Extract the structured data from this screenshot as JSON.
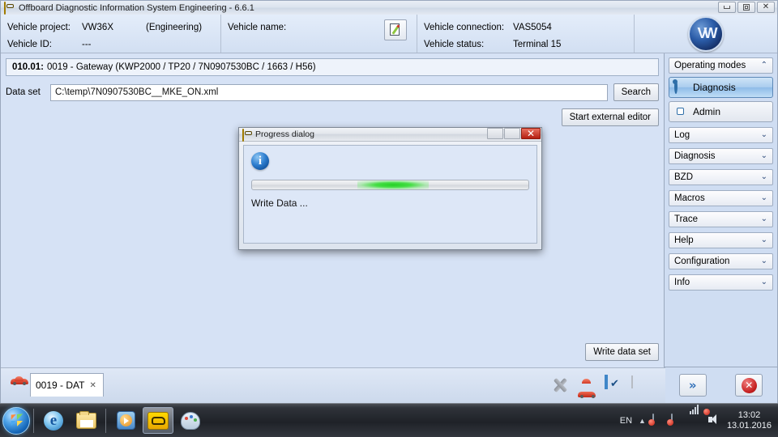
{
  "window": {
    "title": "Offboard Diagnostic Information System Engineering - 6.6.1",
    "icon": "odis-icon",
    "minimize_label": "",
    "maximize_label": "",
    "close_label": "✕"
  },
  "header": {
    "vehicle_project_label": "Vehicle project:",
    "vehicle_project_value": "VW36X",
    "vehicle_project_mode": "(Engineering)",
    "vehicle_id_label": "Vehicle ID:",
    "vehicle_id_value": "---",
    "vehicle_name_label": "Vehicle name:",
    "vehicle_name_value": "",
    "vehicle_connection_label": "Vehicle connection:",
    "vehicle_connection_value": "VAS5054",
    "vehicle_status_label": "Vehicle status:",
    "vehicle_status_value": "Terminal 15",
    "edit_icon": "edit-document-pencil-icon",
    "logo_text": "VW"
  },
  "main": {
    "ecu_number": "010.01:",
    "ecu_description": "0019 - Gateway  (KWP2000 / TP20 / 7N0907530BC / 1663 / H56)",
    "dataset_label": "Data set",
    "dataset_value": "C:\\temp\\7N0907530BC__MKE_ON.xml",
    "dataset_placeholder": "",
    "search_button": "Search",
    "start_external_editor_button": "Start external editor",
    "write_data_set_button": "Write data set"
  },
  "dialog": {
    "title": "Progress dialog",
    "icon": "odis-icon",
    "info_icon": "info-icon",
    "status_text": "Write Data ...",
    "progress_indeterminate": true,
    "progress_color": "#2bd12b",
    "minimize_label": "",
    "maximize_label": "",
    "close_label": "✕"
  },
  "sidebar": {
    "operating_modes": {
      "title": "Operating modes",
      "chevron": "⌃",
      "items": [
        {
          "label": "Diagnosis",
          "icon": "stethoscope-icon",
          "active": true
        },
        {
          "label": "Admin",
          "icon": "gear-icon",
          "active": false
        }
      ]
    },
    "panels": [
      {
        "label": "Log",
        "chevron": "⌄"
      },
      {
        "label": "Diagnosis",
        "chevron": "⌄"
      },
      {
        "label": "BZD",
        "chevron": "⌄"
      },
      {
        "label": "Macros",
        "chevron": "⌄"
      },
      {
        "label": "Trace",
        "chevron": "⌄"
      },
      {
        "label": "Help",
        "chevron": "⌄"
      },
      {
        "label": "Configuration",
        "chevron": "⌄"
      },
      {
        "label": "Info",
        "chevron": "⌄"
      }
    ],
    "footer": {
      "forward_icon": "double-chevron-right-icon",
      "forward_glyph": "»",
      "cancel_icon": "cancel-icon",
      "cancel_glyph": "✕"
    }
  },
  "bottom_bar": {
    "tab_label": "0019 - DAT",
    "tab_icon": "car-icon",
    "tab_close_glyph": "✕",
    "status_icons": [
      {
        "name": "disconnect-icon"
      },
      {
        "name": "car-icon"
      },
      {
        "name": "checkbox-window-icon"
      },
      {
        "name": "grid-icon"
      }
    ]
  },
  "taskbar": {
    "start_label": "Start",
    "items": [
      {
        "name": "internet-explorer-icon",
        "glyph": "e",
        "active": false
      },
      {
        "name": "windows-explorer-icon",
        "glyph": "",
        "active": false
      },
      {
        "name": "media-player-icon",
        "glyph": "",
        "active": false
      },
      {
        "name": "odis-engineering-icon",
        "glyph": "",
        "active": true
      },
      {
        "name": "paint-icon",
        "glyph": "",
        "active": false
      }
    ],
    "tray": {
      "language": "EN",
      "caret": "▲",
      "time": "13:02",
      "date": "13.01.2016"
    }
  }
}
